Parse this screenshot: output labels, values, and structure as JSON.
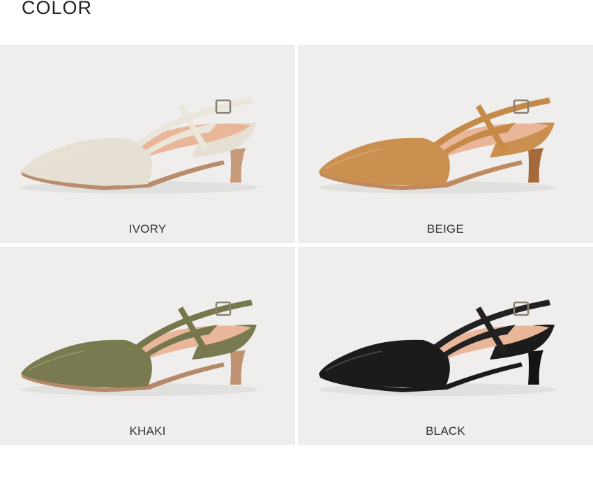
{
  "heading": "COLOR",
  "variants": [
    {
      "label": "IVORY",
      "upper": "#e6e0d4",
      "strap": "#ebe6da",
      "heel": "#c79a7a",
      "sole": "#b88d6e"
    },
    {
      "label": "BEIGE",
      "upper": "#c9904f",
      "strap": "#c58a48",
      "heel": "#a56a3c",
      "sole": "#c08a60"
    },
    {
      "label": "KHAKI",
      "upper": "#7a7a50",
      "strap": "#76774d",
      "heel": "#c09170",
      "sole": "#b5886a"
    },
    {
      "label": "BLACK",
      "upper": "#1b1b1b",
      "strap": "#222222",
      "heel": "#141414",
      "sole": "#1a1a1a"
    }
  ],
  "lining": "#e9b69a"
}
